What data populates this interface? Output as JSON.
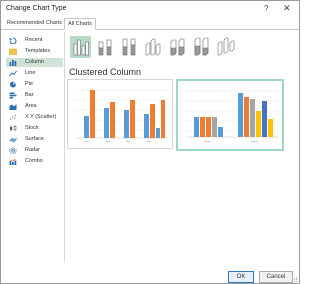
{
  "window": {
    "title": "Change Chart Type",
    "help_icon": "?",
    "close_icon": "✕"
  },
  "tabs": [
    {
      "label": "Recommended Charts",
      "active": false
    },
    {
      "label": "All Charts",
      "active": true
    }
  ],
  "sidebar": {
    "items": [
      {
        "label": "Recent",
        "icon": "recent-icon",
        "selected": false
      },
      {
        "label": "Templates",
        "icon": "templates-icon",
        "selected": false
      },
      {
        "label": "Column",
        "icon": "column-chart-icon",
        "selected": true
      },
      {
        "label": "Line",
        "icon": "line-chart-icon",
        "selected": false
      },
      {
        "label": "Pie",
        "icon": "pie-chart-icon",
        "selected": false
      },
      {
        "label": "Bar",
        "icon": "bar-chart-icon",
        "selected": false
      },
      {
        "label": "Area",
        "icon": "area-chart-icon",
        "selected": false
      },
      {
        "label": "X Y (Scatter)",
        "icon": "scatter-chart-icon",
        "selected": false
      },
      {
        "label": "Stock",
        "icon": "stock-chart-icon",
        "selected": false
      },
      {
        "label": "Surface",
        "icon": "surface-chart-icon",
        "selected": false
      },
      {
        "label": "Radar",
        "icon": "radar-chart-icon",
        "selected": false
      },
      {
        "label": "Combo",
        "icon": "combo-chart-icon",
        "selected": false
      }
    ]
  },
  "subtypes": [
    {
      "icon": "clustered-column-icon",
      "selected": true
    },
    {
      "icon": "stacked-column-icon",
      "selected": false
    },
    {
      "icon": "100-stacked-column-icon",
      "selected": false
    },
    {
      "icon": "3d-clustered-column-icon",
      "selected": false
    },
    {
      "icon": "3d-stacked-column-icon",
      "selected": false
    },
    {
      "icon": "3d-100-stacked-column-icon",
      "selected": false
    },
    {
      "icon": "3d-column-icon",
      "selected": false
    }
  ],
  "chart_heading": "Clustered Column",
  "buttons": {
    "ok": "OK",
    "cancel": "Cancel"
  },
  "colors": {
    "accent": "#217346",
    "selection": "#cfe3d6",
    "blue": "#5b9bd5",
    "orange": "#ed7d31",
    "gray": "#a5a5a5",
    "gold": "#ffc000"
  }
}
